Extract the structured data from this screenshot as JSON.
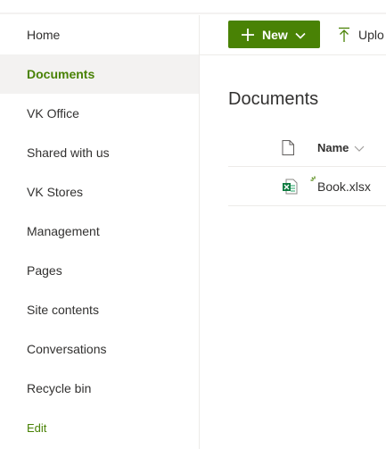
{
  "left_nav": {
    "items": [
      {
        "label": "Home"
      },
      {
        "label": "Documents",
        "selected": true
      },
      {
        "label": "VK Office"
      },
      {
        "label": "Shared with us"
      },
      {
        "label": "VK Stores"
      },
      {
        "label": "Management"
      },
      {
        "label": "Pages"
      },
      {
        "label": "Site contents"
      },
      {
        "label": "Conversations"
      },
      {
        "label": "Recycle bin"
      }
    ],
    "edit_label": "Edit"
  },
  "command_bar": {
    "new_label": "New",
    "upload_label": "Uplo"
  },
  "main": {
    "title": "Documents",
    "columns": {
      "name": "Name"
    },
    "files": [
      {
        "name": "Book.xlsx",
        "type_icon": "excel-file-icon",
        "is_new": true
      }
    ]
  },
  "colors": {
    "accent": "#498205",
    "nav_selected_bg": "#f3f2f1",
    "divider": "#edebe9",
    "text": "#323130"
  }
}
